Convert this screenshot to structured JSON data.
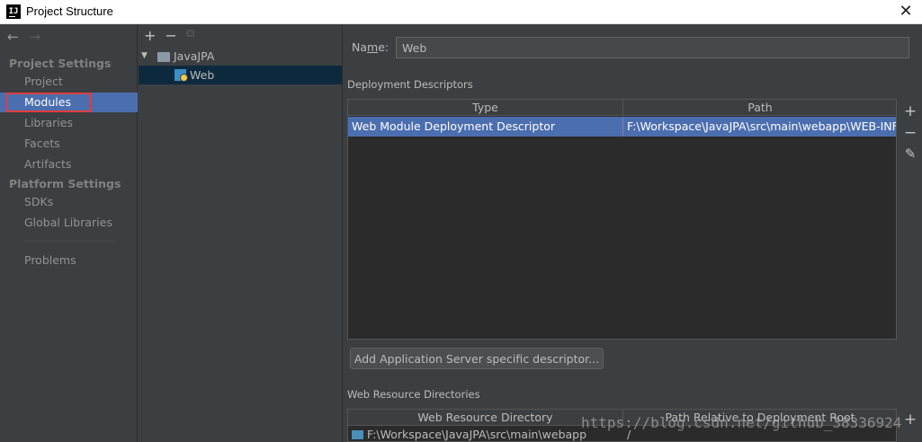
{
  "window": {
    "title": "Project Structure",
    "app_icon_text": "IJ",
    "close_glyph": "✕"
  },
  "nav": {
    "back_glyph": "←",
    "forward_glyph": "→",
    "project_settings_header": "Project Settings",
    "platform_settings_header": "Platform Settings",
    "items": [
      {
        "label": "Project"
      },
      {
        "label": "Modules"
      },
      {
        "label": "Libraries"
      },
      {
        "label": "Facets"
      },
      {
        "label": "Artifacts"
      },
      {
        "label": "SDKs"
      },
      {
        "label": "Global Libraries"
      },
      {
        "label": "Problems"
      }
    ]
  },
  "modules": {
    "add_glyph": "+",
    "remove_glyph": "−",
    "copy_glyph": "⧉",
    "tree": [
      {
        "label": "JavaJPA",
        "expander": "▼"
      },
      {
        "label": "Web"
      }
    ]
  },
  "facet": {
    "name_label_prefix": "Na",
    "name_label_mnemonic": "m",
    "name_label_suffix": "e:",
    "name_value": "Web",
    "deployment_title": "Deployment Descriptors",
    "deployment_columns": [
      "Type",
      "Path"
    ],
    "deployment_row": {
      "type": "Web Module Deployment Descriptor",
      "path": "F:\\Workspace\\JavaJPA\\src\\main\\webapp\\WEB-INF\\"
    },
    "add_glyph": "+",
    "remove_glyph": "−",
    "edit_glyph": "✎",
    "add_server_button": "Add Application Server specific descriptor...",
    "resource_title": "Web Resource Directories",
    "resource_columns": [
      "Web Resource Directory",
      "Path Relative to Deployment Root"
    ],
    "resource_row": {
      "dir": "F:\\Workspace\\JavaJPA\\src\\main\\webapp",
      "relative": "/"
    }
  },
  "watermark": "https://blog.csdn.net/github_38336924",
  "colors": {
    "background": "#3c3f41",
    "selection": "#4b6eaf",
    "highlight_box": "#e23c3c",
    "tree_selection": "#0d293e"
  }
}
